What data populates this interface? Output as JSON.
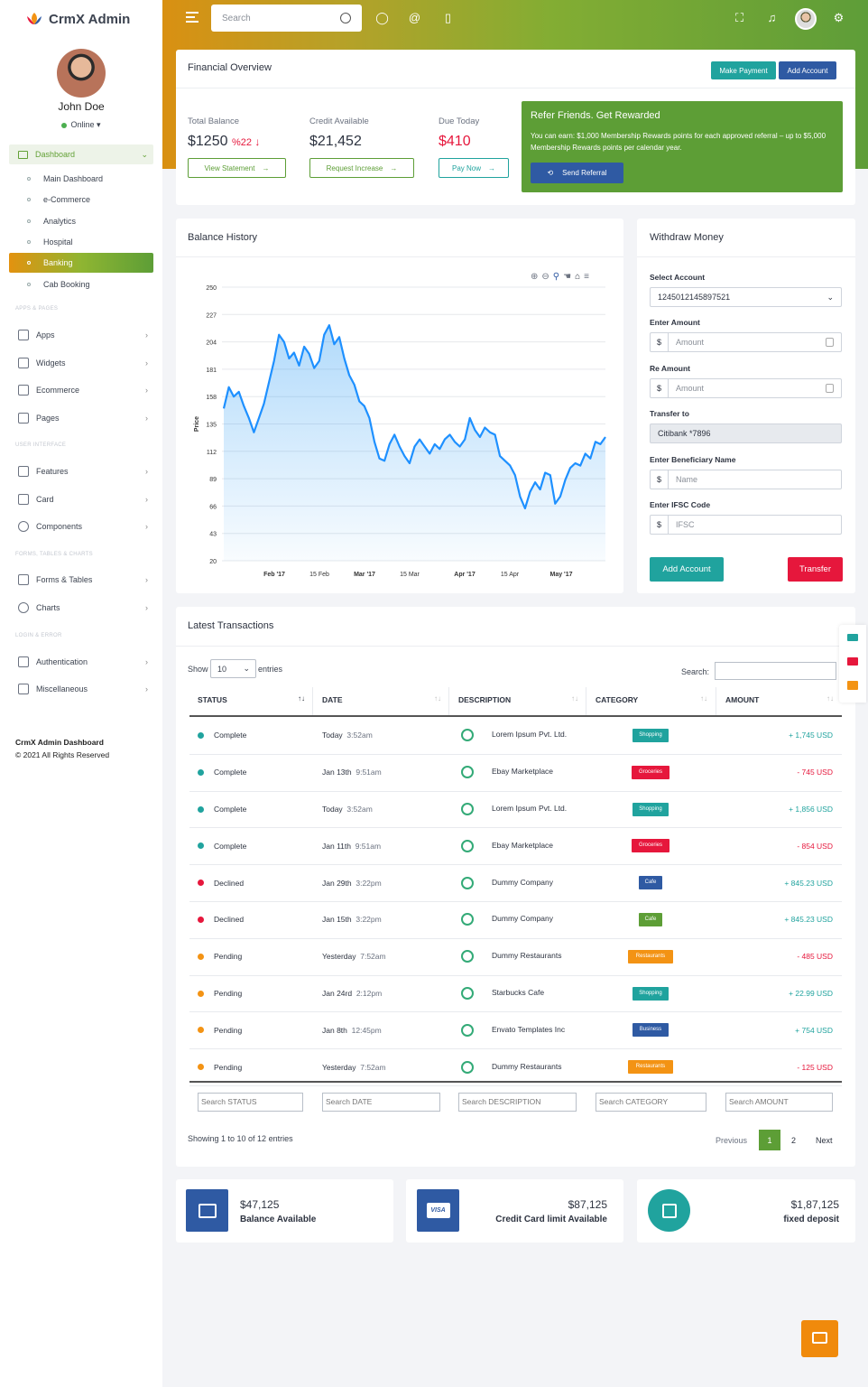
{
  "app": {
    "title": "CrmX Admin"
  },
  "user": {
    "name": "John Doe",
    "status": "Online"
  },
  "sidebar": {
    "dashboard": "Dashboard",
    "sub": [
      "Main Dashboard",
      "e-Commerce",
      "Analytics",
      "Hospital",
      "Banking",
      "Cab Booking"
    ],
    "section1": "APPS & PAGES",
    "group1": [
      "Apps",
      "Widgets",
      "Ecommerce",
      "Pages"
    ],
    "section2": "USER INTERFACE",
    "group2": [
      "Features",
      "Card",
      "Components"
    ],
    "section3": "FORMS, TABLES & CHARTS",
    "group3": [
      "Forms & Tables",
      "Charts"
    ],
    "section4": "LOGIN & ERROR",
    "group4": [
      "Authentication",
      "Miscellaneous"
    ],
    "footer_title": "CrmX Admin Dashboard",
    "footer_copy": "© 2021 All Rights Reserved"
  },
  "topbar": {
    "search_placeholder": "Search"
  },
  "overview": {
    "title": "Financial Overview",
    "make_payment": "Make Payment",
    "add_account": "Add Account",
    "total_balance_label": "Total Balance",
    "total_balance": "$1250",
    "total_change": "%22",
    "view_statement": "View Statement",
    "credit_label": "Credit Available",
    "credit": "$21,452",
    "request_increase": "Request Increase",
    "due_label": "Due Today",
    "due": "$410",
    "pay_now": "Pay Now",
    "refer_title": "Refer Friends. Get Rewarded",
    "refer_text": "You can earn: $1,000 Membership Rewards points for each approved referral – up to $5,000 Membership Rewards points per calendar year.",
    "send_referral": "Send Referral"
  },
  "balance_history": {
    "title": "Balance History"
  },
  "chart_data": {
    "type": "area",
    "title": "Balance History",
    "ylabel": "Price",
    "ylim": [
      20,
      250
    ],
    "yticks": [
      250,
      227,
      204,
      181,
      158,
      135,
      112,
      89,
      66,
      43,
      20
    ],
    "xticks": [
      "Feb '17",
      "15 Feb",
      "Mar '17",
      "15 Mar",
      "Apr '17",
      "15 Apr",
      "May '17"
    ],
    "x": [
      0,
      1,
      2,
      3,
      4,
      5,
      6,
      7,
      8,
      9,
      10,
      11,
      12,
      13,
      14,
      15,
      16,
      17,
      18,
      19,
      20,
      21,
      22,
      23,
      24,
      25,
      26,
      27,
      28,
      29,
      30,
      31,
      32,
      33,
      34,
      35,
      36,
      37,
      38,
      39,
      40,
      41,
      42,
      43,
      44,
      45,
      46,
      47,
      48,
      49,
      50,
      51,
      52,
      53,
      54,
      55,
      56,
      57,
      58,
      59,
      60,
      61,
      62,
      63,
      64,
      65,
      66,
      67,
      68,
      69,
      70,
      71,
      72,
      73,
      74,
      75,
      76,
      77,
      78,
      79,
      80,
      81,
      82,
      83,
      84,
      85,
      86,
      87,
      88,
      89,
      90,
      91,
      92,
      93,
      94,
      95,
      96,
      97,
      98,
      99
    ],
    "series": [
      {
        "values": [
          148,
          166,
          158,
          162,
          150,
          140,
          128,
          140,
          152,
          170,
          188,
          210,
          204,
          190,
          195,
          184,
          200,
          194,
          182,
          188,
          210,
          218,
          202,
          208,
          190,
          176,
          168,
          154,
          150,
          140,
          120,
          106,
          104,
          118,
          126,
          116,
          108,
          102,
          116,
          122,
          116,
          110,
          118,
          114,
          122,
          126,
          120,
          116,
          122,
          140,
          130,
          124,
          132,
          128,
          126,
          108,
          104,
          100,
          92,
          74,
          64,
          78,
          86,
          80,
          94,
          92,
          68,
          74,
          88,
          98,
          102,
          100,
          110,
          106,
          120,
          118,
          124
        ]
      }
    ]
  },
  "withdraw": {
    "title": "Withdraw Money",
    "select_label": "Select Account",
    "account": "1245012145897521",
    "amount_label": "Enter Amount",
    "amount_ph": "Amount",
    "re_amount_label": "Re Amount",
    "transfer_label": "Transfer to",
    "transfer_value": "Citibank *7896",
    "beneficiary_label": "Enter Beneficiary Name",
    "name_ph": "Name",
    "ifsc_label": "Enter IFSC Code",
    "ifsc_ph": "IFSC",
    "currency": "$",
    "add_account": "Add Account",
    "transfer": "Transfer"
  },
  "transactions": {
    "title": "Latest Transactions",
    "show": "Show",
    "entries_value": "10",
    "entries": "entries",
    "search_label": "Search:",
    "headers": [
      "STATUS",
      "DATE",
      "DESCRIPTION",
      "CATEGORY",
      "AMOUNT"
    ],
    "rows": [
      {
        "status": "Complete",
        "date": "Today",
        "time": "3:52am",
        "desc": "Lorem Ipsum Pvt. Ltd.",
        "cat": "Shopping",
        "amount": "+ 1,745 USD",
        "sc": "#20a39e",
        "cc": "#20a39e",
        "ac": "#20a39e"
      },
      {
        "status": "Complete",
        "date": "Jan 13th",
        "time": "9:51am",
        "desc": "Ebay Marketplace",
        "cat": "Groceries",
        "amount": "- 745 USD",
        "sc": "#20a39e",
        "cc": "#e6173c",
        "ac": "#e6173c"
      },
      {
        "status": "Complete",
        "date": "Today",
        "time": "3:52am",
        "desc": "Lorem Ipsum Pvt. Ltd.",
        "cat": "Shopping",
        "amount": "+ 1,856 USD",
        "sc": "#20a39e",
        "cc": "#20a39e",
        "ac": "#20a39e"
      },
      {
        "status": "Complete",
        "date": "Jan 11th",
        "time": "9:51am",
        "desc": "Ebay Marketplace",
        "cat": "Groceries",
        "amount": "- 854 USD",
        "sc": "#20a39e",
        "cc": "#e6173c",
        "ac": "#e6173c"
      },
      {
        "status": "Declined",
        "date": "Jan 29th",
        "time": "3:22pm",
        "desc": "Dummy Company",
        "cat": "Cafe",
        "amount": "+ 845.23 USD",
        "sc": "#e6173c",
        "cc": "#2f5aa3",
        "ac": "#20a39e"
      },
      {
        "status": "Declined",
        "date": "Jan 15th",
        "time": "3:22pm",
        "desc": "Dummy Company",
        "cat": "Cafe",
        "amount": "+ 845.23 USD",
        "sc": "#e6173c",
        "cc": "#5d9e36",
        "ac": "#20a39e"
      },
      {
        "status": "Pending",
        "date": "Yesterday",
        "time": "7:52am",
        "desc": "Dummy Restaurants",
        "cat": "Restaurants",
        "amount": "- 485 USD",
        "sc": "#f39314",
        "cc": "#f39314",
        "ac": "#e6173c"
      },
      {
        "status": "Pending",
        "date": "Jan 24rd",
        "time": "2:12pm",
        "desc": "Starbucks Cafe",
        "cat": "Shopping",
        "amount": "+ 22.99 USD",
        "sc": "#f39314",
        "cc": "#20a39e",
        "ac": "#20a39e"
      },
      {
        "status": "Pending",
        "date": "Jan 8th",
        "time": "12:45pm",
        "desc": "Envato Templates Inc",
        "cat": "Business",
        "amount": "+ 754 USD",
        "sc": "#f39314",
        "cc": "#2f5aa3",
        "ac": "#20a39e"
      },
      {
        "status": "Pending",
        "date": "Yesterday",
        "time": "7:52am",
        "desc": "Dummy Restaurants",
        "cat": "Restaurants",
        "amount": "- 125 USD",
        "sc": "#f39314",
        "cc": "#f39314",
        "ac": "#e6173c"
      }
    ],
    "filters": [
      "Search STATUS",
      "Search DATE",
      "Search DESCRIPTION",
      "Search CATEGORY",
      "Search AMOUNT"
    ],
    "info": "Showing 1 to 10 of 12 entries",
    "prev": "Previous",
    "page1": "1",
    "page2": "2",
    "next": "Next"
  },
  "summary": [
    {
      "value": "$47,125",
      "label": "Balance Available"
    },
    {
      "value": "$87,125",
      "label": "Credit Card limit Available",
      "card_text": "VISA"
    },
    {
      "value": "$1,87,125",
      "label": "fixed deposit"
    }
  ],
  "colors": {
    "brand_green": "#5d9e36",
    "brand_orange": "#f39314",
    "red": "#e6173c",
    "teal": "#20a39e",
    "blue": "#2f5aa3"
  }
}
